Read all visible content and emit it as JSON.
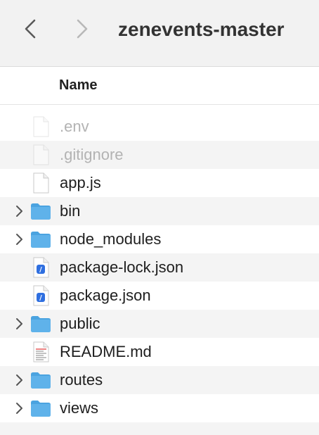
{
  "window": {
    "title": "zenevents-master"
  },
  "header": {
    "name_label": "Name"
  },
  "files": [
    {
      "name": ".env",
      "kind": "file",
      "hidden": true
    },
    {
      "name": ".gitignore",
      "kind": "file",
      "hidden": true
    },
    {
      "name": "app.js",
      "kind": "file",
      "hidden": false
    },
    {
      "name": "bin",
      "kind": "folder",
      "hidden": false
    },
    {
      "name": "node_modules",
      "kind": "folder",
      "hidden": false
    },
    {
      "name": "package-lock.json",
      "kind": "json",
      "hidden": false
    },
    {
      "name": "package.json",
      "kind": "json",
      "hidden": false
    },
    {
      "name": "public",
      "kind": "folder",
      "hidden": false
    },
    {
      "name": "README.md",
      "kind": "markdown",
      "hidden": false
    },
    {
      "name": "routes",
      "kind": "folder",
      "hidden": false
    },
    {
      "name": "views",
      "kind": "folder",
      "hidden": false
    }
  ],
  "icons": {
    "back": "chevron-left-icon",
    "forward": "chevron-right-icon",
    "folder": "folder-icon",
    "file": "document-icon",
    "json": "json-file-icon",
    "markdown": "markdown-file-icon",
    "disclosure": "chevron-right-icon"
  },
  "colors": {
    "folder": "#5fb2ea",
    "hidden_text": "#b3b3b3",
    "json_badge": "#2f6fe0"
  }
}
